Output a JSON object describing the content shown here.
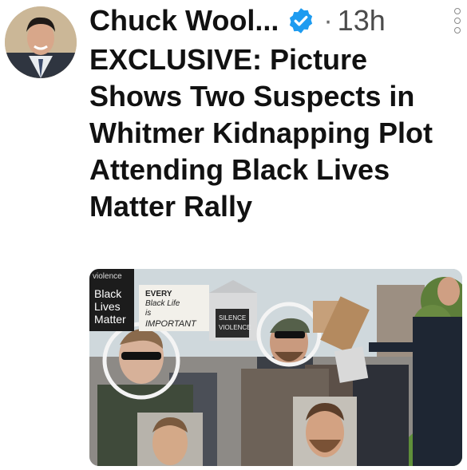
{
  "post": {
    "author_name": "Chuck Wool...",
    "time": "13h",
    "separator": "·",
    "headline": "EXCLUSIVE: Picture Shows Two Suspects in Whitmer Kidnapping Plot Attending Black Lives Matter Rally"
  },
  "photo": {
    "signs": {
      "violence": "violence",
      "black": "Black",
      "lives": "Lives",
      "matter": "Matter",
      "every": "EVERY",
      "black_life": "Black Life",
      "is": "is",
      "important": "IMPORTANT",
      "silence": "SILENCE",
      "violence2": "VIOLENCE"
    }
  },
  "colors": {
    "verified": "#1d9bf0",
    "sky": "#cfd8dc",
    "grass": "#5f8f3a",
    "road": "#8d8a86",
    "circle": "#f4f4f4"
  },
  "icons": {
    "verified": "verified-badge-icon",
    "more": "more-options-icon"
  }
}
